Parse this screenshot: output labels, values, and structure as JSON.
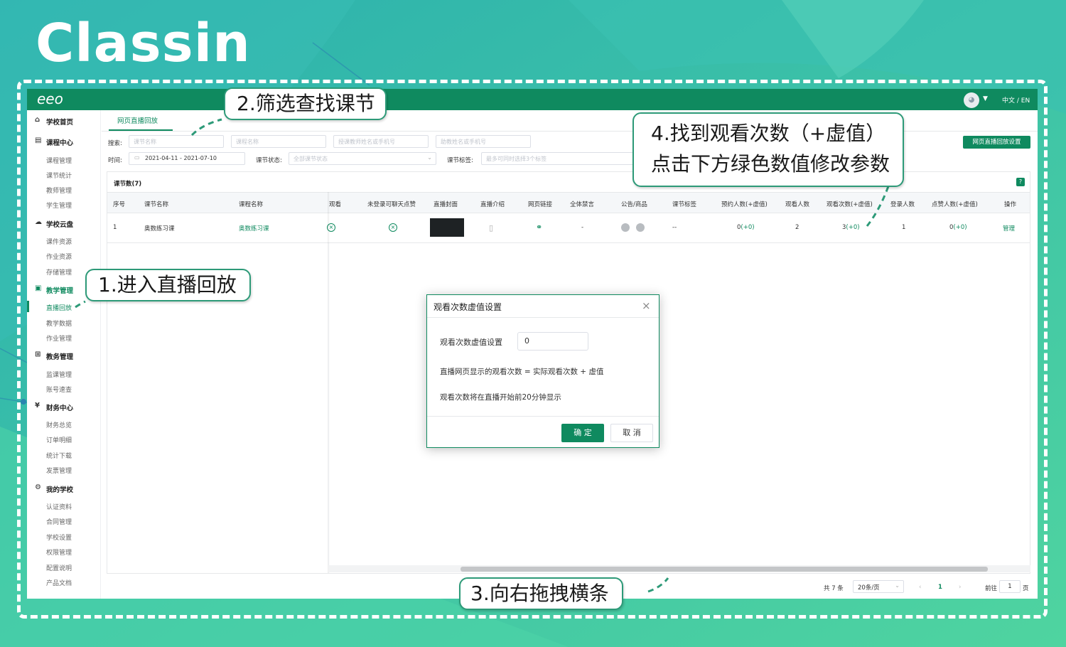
{
  "brand": "Classin",
  "app": {
    "logo": "eeo",
    "lang": "中文 / EN",
    "avatar_icon": "avatar-icon"
  },
  "sidebar": {
    "items": [
      {
        "type": "group",
        "label": "学校首页",
        "icon": "home-icon",
        "glyph": "⌂"
      },
      {
        "type": "group",
        "label": "课程中心",
        "icon": "calendar-icon",
        "glyph": "▤"
      },
      {
        "type": "item",
        "label": "课程管理"
      },
      {
        "type": "item",
        "label": "课节统计"
      },
      {
        "type": "item",
        "label": "教师管理"
      },
      {
        "type": "item",
        "label": "学生管理"
      },
      {
        "type": "group",
        "label": "学校云盘",
        "icon": "cloud-icon",
        "glyph": "☁"
      },
      {
        "type": "item",
        "label": "课件资源"
      },
      {
        "type": "item",
        "label": "作业资源"
      },
      {
        "type": "item",
        "label": "存储管理"
      },
      {
        "type": "group",
        "label": "教学管理",
        "icon": "monitor-icon",
        "glyph": "▣",
        "highlight": true
      },
      {
        "type": "item",
        "label": "直播回放",
        "active": true
      },
      {
        "type": "item",
        "label": "教学数据"
      },
      {
        "type": "item",
        "label": "作业管理"
      },
      {
        "type": "group",
        "label": "教务管理",
        "icon": "grid-icon",
        "glyph": "⊞"
      },
      {
        "type": "item",
        "label": "监课管理"
      },
      {
        "type": "item",
        "label": "账号速查"
      },
      {
        "type": "group",
        "label": "财务中心",
        "icon": "yen-icon",
        "glyph": "¥"
      },
      {
        "type": "item",
        "label": "财务总览"
      },
      {
        "type": "item",
        "label": "订单明细"
      },
      {
        "type": "item",
        "label": "统计下载"
      },
      {
        "type": "item",
        "label": "发票管理"
      },
      {
        "type": "group",
        "label": "我的学校",
        "icon": "gear-icon",
        "glyph": "⚙"
      },
      {
        "type": "item",
        "label": "认证资料"
      },
      {
        "type": "item",
        "label": "合同管理"
      },
      {
        "type": "item",
        "label": "学校设置"
      },
      {
        "type": "item",
        "label": "权限管理"
      },
      {
        "type": "item",
        "label": "配置说明"
      },
      {
        "type": "item",
        "label": "产品文档"
      }
    ]
  },
  "tab": {
    "title": "网页直播回放"
  },
  "filters": {
    "search_label": "搜索:",
    "lesson_name_ph": "课节名称",
    "course_name_ph": "课程名称",
    "teacher_ph": "授课教师姓名或手机号",
    "assistant_ph": "助教姓名或手机号",
    "time_label": "时间:",
    "date_range": "2021-04-11   - 2021-07-10",
    "status_label": "课节状态:",
    "status_ph": "全部课节状态",
    "tag_label": "课节标签:",
    "tag_ph": "最多可同时选择3个标签",
    "settings_button": "网页直播回放设置"
  },
  "table": {
    "count_label": "课节数(7)",
    "help": "?",
    "headers": [
      "序号",
      "课节名称",
      "课程名称",
      "观看",
      "未登录可聊天点赞",
      "直播封面",
      "直播介绍",
      "网页链接",
      "全体禁言",
      "公告/商品",
      "课节标签",
      "预约人数(+虚值)",
      "观看人数",
      "观看次数(+虚值)",
      "登录人数",
      "点赞人数(+虚值)",
      "操作"
    ],
    "row": {
      "index": "1",
      "lesson": "奥数练习课",
      "course": "奥数练习课",
      "mute": "-",
      "tag": "--",
      "reserve_main": "0",
      "reserve_extra": "(+0)",
      "viewers": "2",
      "views_main": "3",
      "views_extra": "(+0)",
      "logins": "1",
      "likes_main": "0",
      "likes_extra": "(+0)",
      "action": "管理"
    }
  },
  "pagination": {
    "total": "共 7 条",
    "per_page": "20条/页",
    "prev": "‹",
    "page": "1",
    "next": "›",
    "goto_label": "前往",
    "goto_value": "1",
    "page_suffix": "页"
  },
  "modal": {
    "title": "观看次数虚值设置",
    "close": "×",
    "field_label": "观看次数虚值设置",
    "field_value": "0",
    "line1": "直播网页显示的观看次数 = 实际观看次数 + 虚值",
    "line2": "观看次数将在直播开始前20分钟显示",
    "ok": "确 定",
    "cancel": "取 消"
  },
  "callouts": {
    "c1": "1.进入直播回放",
    "c2": "2.筛选查找课节",
    "c3": "3.向右拖拽横条",
    "c4_line1": "4.找到观看次数（+虚值）",
    "c4_line2": "点击下方绿色数值修改参数"
  },
  "colors": {
    "brand_green": "#0f8a5f",
    "bg_teal": "#2fb4a8",
    "callout_border": "#2d9a78"
  }
}
